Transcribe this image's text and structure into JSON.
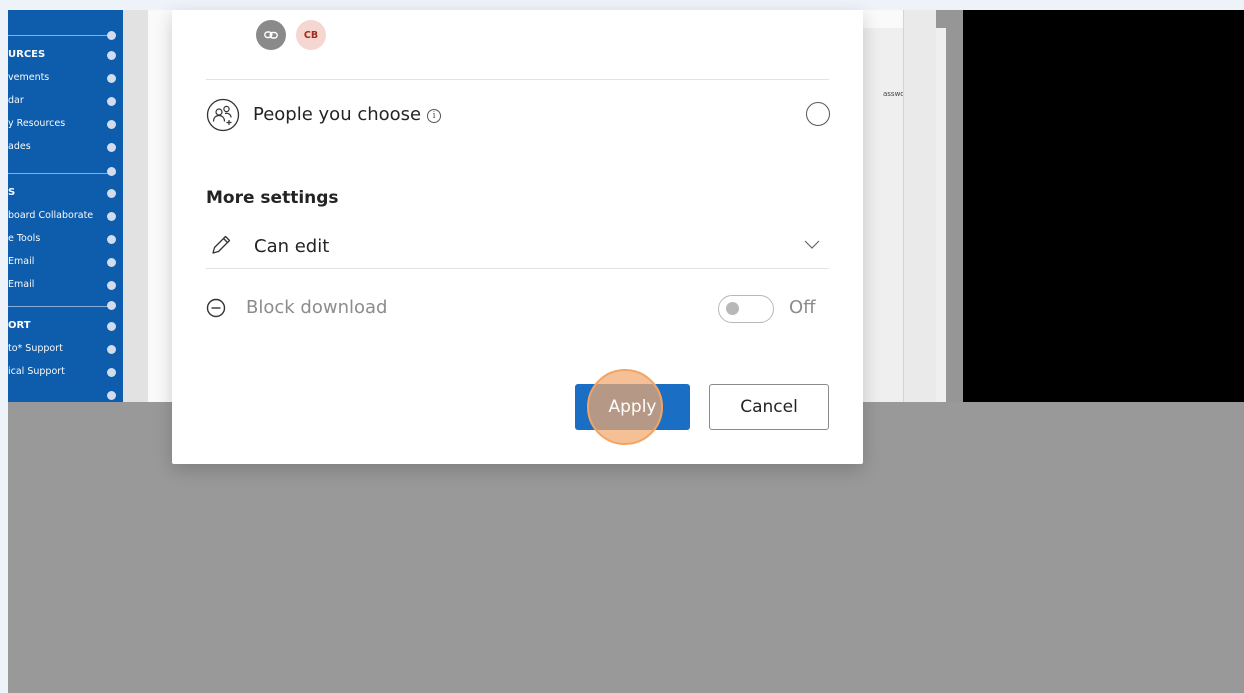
{
  "background_app": {
    "sidebar": {
      "items": [
        {
          "label": "URCES",
          "head": true
        },
        {
          "label": "vements"
        },
        {
          "label": "dar"
        },
        {
          "label": "y Resources"
        },
        {
          "label": "ades"
        },
        {
          "label": "S",
          "head": true
        },
        {
          "label": "board Collaborate"
        },
        {
          "label": "e Tools"
        },
        {
          "label": "Email"
        },
        {
          "label": " Email"
        },
        {
          "label": "ORT",
          "head": true
        },
        {
          "label": "to* Support"
        },
        {
          "label": "ical Support"
        }
      ]
    },
    "snippet_text": "assword."
  },
  "dialog": {
    "avatars": {
      "link_icon": "link-icon",
      "initials": "CB"
    },
    "people_option": {
      "label": "People you choose",
      "info_glyph": "i",
      "icon": "people-add-icon"
    },
    "more_settings": {
      "title": "More settings",
      "permission": {
        "value": "Can edit",
        "icon": "pencil-icon",
        "dropdown_icon": "chevron-down-icon"
      },
      "block_download": {
        "label": "Block download",
        "state": "Off",
        "icon": "minus-circle-icon"
      }
    },
    "buttons": {
      "apply": "Apply",
      "cancel": "Cancel"
    }
  },
  "colors": {
    "primary": "#1a6fc4",
    "sidebar": "#0e5fb0",
    "click_highlight": "#f3a463"
  }
}
